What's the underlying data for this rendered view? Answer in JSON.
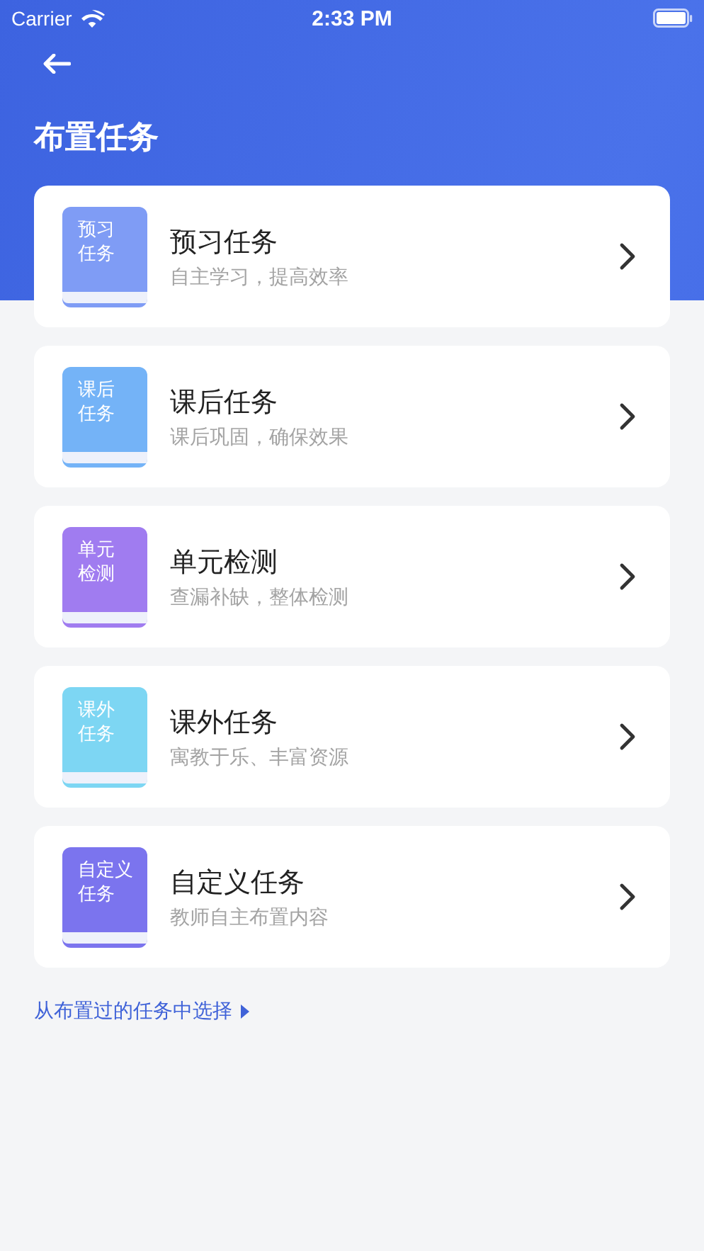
{
  "status_bar": {
    "carrier": "Carrier",
    "time": "2:33 PM"
  },
  "header": {
    "title": "布置任务"
  },
  "tasks": [
    {
      "book_lines": [
        "预习",
        "任务"
      ],
      "title": "预习任务",
      "subtitle": "自主学习，提高效率",
      "color": "#7f9cf5"
    },
    {
      "book_lines": [
        "课后",
        "任务"
      ],
      "title": "课后任务",
      "subtitle": "课后巩固，确保效果",
      "color": "#74b3f7"
    },
    {
      "book_lines": [
        "单元",
        "检测"
      ],
      "title": "单元检测",
      "subtitle": "查漏补缺，整体检测",
      "color": "#a07cf0"
    },
    {
      "book_lines": [
        "课外",
        "任务"
      ],
      "title": "课外任务",
      "subtitle": "寓教于乐、丰富资源",
      "color": "#7dd6f3"
    },
    {
      "book_lines": [
        "自定义",
        "任务"
      ],
      "title": "自定义任务",
      "subtitle": "教师自主布置内容",
      "color": "#7b74ee"
    }
  ],
  "history_link": "从布置过的任务中选择"
}
